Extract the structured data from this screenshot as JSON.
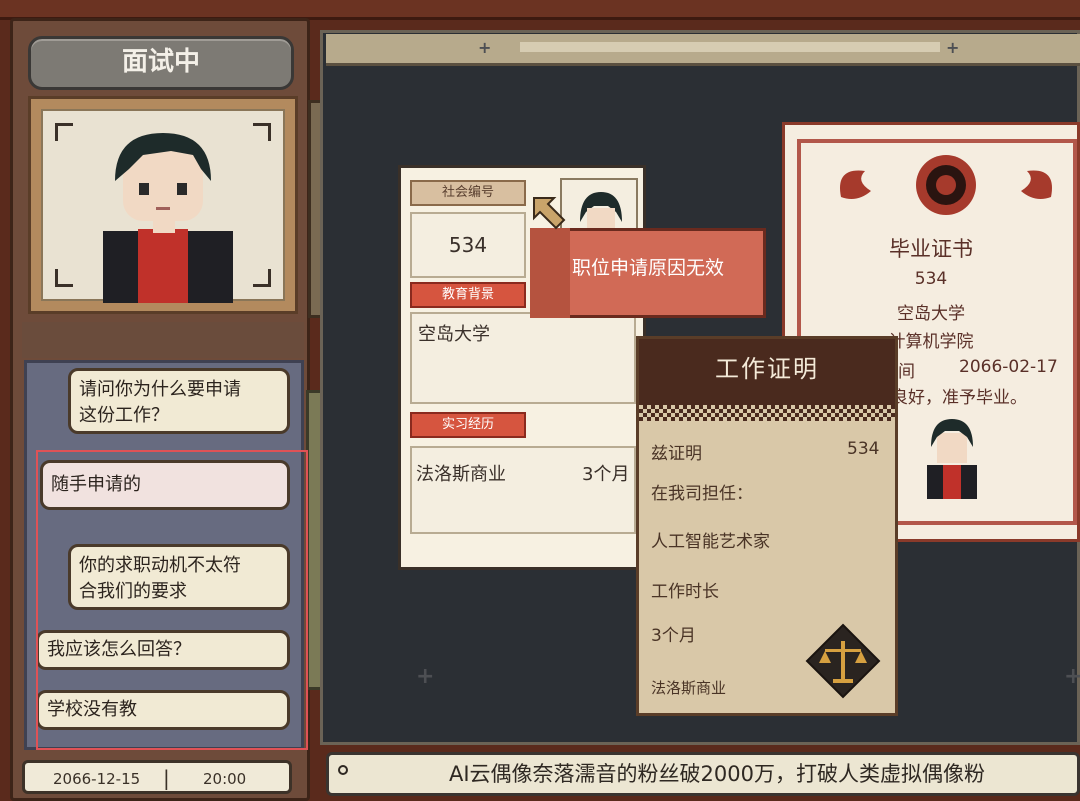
{
  "header": {
    "status_title": "面试中"
  },
  "toolbar": {
    "card_icon": "id-card-icon",
    "help_label": "?",
    "music_label": "♪"
  },
  "dialog": [
    {
      "speaker": "interviewer",
      "text_line1": "请问你为什么要申请",
      "text_line2": "这份工作？"
    },
    {
      "speaker": "option",
      "text": "随手申请的"
    },
    {
      "speaker": "interviewer",
      "text_line1": "你的求职动机不太符",
      "text_line2": "合我们的要求"
    },
    {
      "speaker": "option",
      "text": "我应该怎么回答？"
    },
    {
      "speaker": "option",
      "text": "学校没有教"
    }
  ],
  "status_bar": {
    "date": "2066-12-15",
    "time": "20:00"
  },
  "ticker": {
    "text": "AI云偶像奈落濡音的粉丝破2000万，打破人类虚拟偶像粉"
  },
  "resume": {
    "social_id_label": "社会编号",
    "social_id_value": "534",
    "education_label": "教育背景",
    "education_value": "空岛大学",
    "internship_label": "实习经历",
    "internship_company": "法洛斯商业",
    "internship_duration": "3个月"
  },
  "invalid_reason_banner": "职位申请原因无效",
  "graduation_certificate": {
    "title": "毕业证书",
    "id": "534",
    "university": "空岛大学",
    "college": "计算机学院",
    "date_label": "时间",
    "date_value": "2066-02-17",
    "remark": "良好，准予毕业。"
  },
  "work_certificate": {
    "title": "工作证明",
    "line1_label": "兹证明",
    "line1_value": "534",
    "line2": "在我司担任：",
    "position": "人工智能艺术家",
    "duration_label": "工作时长",
    "duration_value": "3个月",
    "company": "法洛斯商业"
  },
  "colors": {
    "accent_red": "#d6553f",
    "highlight_border": "#e05256",
    "desk_bg": "#2b2f34"
  }
}
